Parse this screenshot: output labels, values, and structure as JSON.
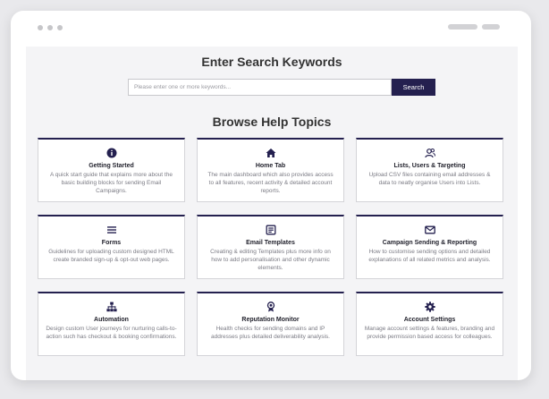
{
  "search": {
    "heading": "Enter Search Keywords",
    "placeholder": "Please enter one or more keywords...",
    "button_label": "Search"
  },
  "browse": {
    "heading": "Browse Help Topics"
  },
  "topics": [
    {
      "icon": "info-icon",
      "title": "Getting Started",
      "description": "A quick start guide that explains more about the basic building blocks for sending Email Campaigns."
    },
    {
      "icon": "home-icon",
      "title": "Home Tab",
      "description": "The main dashboard which also provides access to all features, recent activity & detailed account reports."
    },
    {
      "icon": "users-icon",
      "title": "Lists, Users & Targeting",
      "description": "Upload CSV files containing email addresses & data to neatly organise Users into Lists."
    },
    {
      "icon": "menu-icon",
      "title": "Forms",
      "description": "Guidelines for uploading custom designed HTML create branded sign-up & opt-out web pages."
    },
    {
      "icon": "template-icon",
      "title": "Email Templates",
      "description": "Creating & editing Templates plus more info on how to add personalisation and other dynamic elements."
    },
    {
      "icon": "envelope-icon",
      "title": "Campaign Sending & Reporting",
      "description": "How to customise sending options and detailed explanations of all related metrics and analysis."
    },
    {
      "icon": "sitemap-icon",
      "title": "Automation",
      "description": "Design custom User journeys for nurturing calls-to-action such has checkout & booking confirmations."
    },
    {
      "icon": "award-icon",
      "title": "Reputation Monitor",
      "description": "Health checks for sending domains and IP addresses plus detailed deliverability analysis."
    },
    {
      "icon": "gear-icon",
      "title": "Account Settings",
      "description": "Manage account settings & features, branding and provide permission based access for colleagues."
    }
  ],
  "colors": {
    "accent": "#24204f",
    "background": "#f4f4f6"
  }
}
